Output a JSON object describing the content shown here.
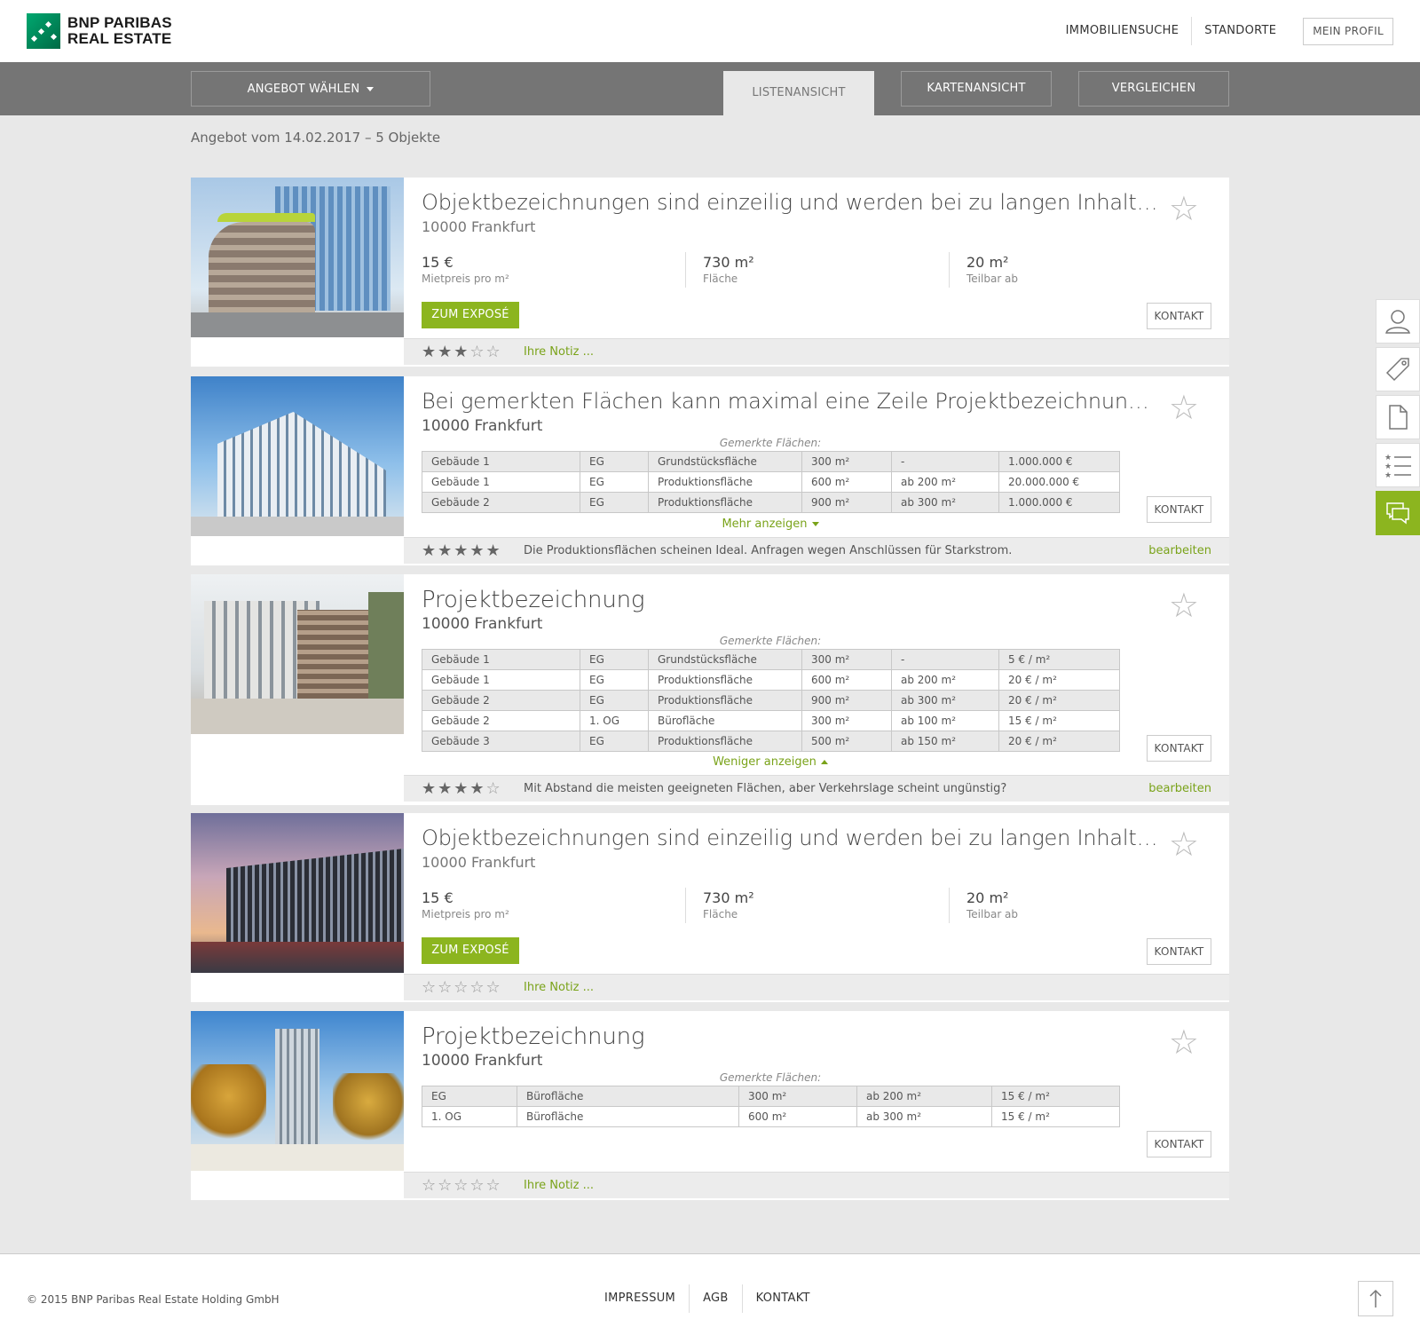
{
  "brand": {
    "line1": "BNP PARIBAS",
    "line2": "REAL ESTATE"
  },
  "topnav": {
    "search": "IMMOBILIENSUCHE",
    "locations": "STANDORTE",
    "profile": "MEIN PROFIL"
  },
  "tabbar": {
    "select_offer": "ANGEBOT WÄHLEN",
    "tabs": [
      "LISTENANSICHT",
      "KARTENANSICHT",
      "VERGLEICHEN"
    ]
  },
  "offer_title": "Angebot vom 14.02.2017 – 5 Objekte",
  "common": {
    "contact": "KONTAKT",
    "expose": "ZUM EXPOSÉ",
    "note_placeholder": "Ihre Notiz ...",
    "edit": "bearbeiten",
    "marked_areas": "Gemerkte Flächen:",
    "show_more": "Mehr anzeigen",
    "show_less": "Weniger anzeigen",
    "label_rent": "Mietpreis pro m²",
    "label_area": "Fläche",
    "label_divisible": "Teilbar ab"
  },
  "cards": [
    {
      "title": "Objektbezeichnungen sind einzeilig und werden bei zu langen Inhalten abgeschnitten",
      "city": "10000 Frankfurt",
      "rent": "15 €",
      "area": "730 m²",
      "divisible": "20 m²",
      "rating": 3
    },
    {
      "title": "Bei gemerkten Flächen kann maximal eine Zeile Projektbezeichnung dargestellt werden",
      "city": "10000 Frankfurt",
      "rows": [
        [
          "Gebäude 1",
          "EG",
          "Grundstücksfläche",
          "300 m²",
          "-",
          "1.000.000 €"
        ],
        [
          "Gebäude 1",
          "EG",
          "Produktionsfläche",
          "600 m²",
          "ab 200 m²",
          "20.000.000 €"
        ],
        [
          "Gebäude 2",
          "EG",
          "Produktionsfläche",
          "900 m²",
          "ab 300 m²",
          "1.000.000 €"
        ]
      ],
      "rating": 5,
      "note": "Die Produktionsflächen scheinen Ideal. Anfragen wegen Anschlüssen für Starkstrom."
    },
    {
      "title": "Projektbezeichnung",
      "city": "10000 Frankfurt",
      "rows": [
        [
          "Gebäude 1",
          "EG",
          "Grundstücksfläche",
          "300 m²",
          "-",
          "5 € / m²"
        ],
        [
          "Gebäude 1",
          "EG",
          "Produktionsfläche",
          "600 m²",
          "ab 200 m²",
          "20 € / m²"
        ],
        [
          "Gebäude 2",
          "EG",
          "Produktionsfläche",
          "900 m²",
          "ab 300 m²",
          "20 € / m²"
        ],
        [
          "Gebäude 2",
          "1. OG",
          "Bürofläche",
          "300 m²",
          "ab 100 m²",
          "15 € / m²"
        ],
        [
          "Gebäude 3",
          "EG",
          "Produktionsfläche",
          "500 m²",
          "ab 150 m²",
          "20 € / m²"
        ]
      ],
      "rating": 4,
      "note": "Mit Abstand die meisten geeigneten Flächen, aber Verkehrslage scheint ungünstig?"
    },
    {
      "title": "Objektbezeichnungen sind einzeilig und werden bei zu langen Inhalten abgeschnitten",
      "city": "10000 Frankfurt",
      "rent": "15 €",
      "area": "730 m²",
      "divisible": "20 m²",
      "rating": 0
    },
    {
      "title": "Projektbezeichnung",
      "city": "10000 Frankfurt",
      "rows": [
        [
          "EG",
          "Bürofläche",
          "300 m²",
          "ab 200 m²",
          "15 € / m²"
        ],
        [
          "1. OG",
          "Bürofläche",
          "600 m²",
          "ab 300 m²",
          "15 € / m²"
        ]
      ],
      "rating": 0
    }
  ],
  "footer": {
    "copyright": "© 2015 BNP Paribas Real Estate Holding GmbH",
    "links": [
      "IMPRESSUM",
      "AGB",
      "KONTAKT"
    ]
  },
  "colors": {
    "accent": "#8cb51f",
    "link": "#7aa31a",
    "bar": "#757575"
  },
  "icons": [
    "profile-icon",
    "tag-icon",
    "document-icon",
    "list-icon",
    "chat-icon",
    "arrow-up-icon",
    "star-icon"
  ]
}
